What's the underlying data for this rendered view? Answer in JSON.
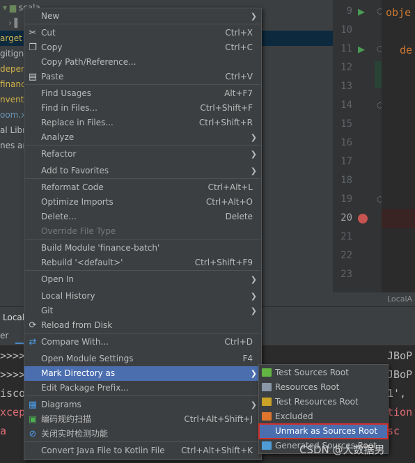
{
  "project_tree": [
    {
      "text": "arget",
      "color": "#d0b34a",
      "selected": true
    },
    {
      "text": "gitigno",
      "color": "#bbbbbb"
    },
    {
      "text": "depend",
      "color": "#d0b34a"
    },
    {
      "text": "finance",
      "color": "#d0b34a"
    },
    {
      "text": "nventor",
      "color": "#d0b34a"
    },
    {
      "text": "oom.x",
      "color": "#6897bb"
    },
    {
      "text": "al Libra",
      "color": "#bbbbbb"
    },
    {
      "text": "nes an",
      "color": "#bbbbbb"
    }
  ],
  "tree_top": {
    "text": "scala"
  },
  "gutter_lines": [
    "9",
    "10",
    "11",
    "12",
    "13",
    "14",
    "15",
    "16",
    "17",
    "18",
    "19",
    "20",
    "21",
    "22",
    "23"
  ],
  "editor_snippets": {
    "line9": "obje",
    "line11": "de"
  },
  "status_strip": {
    "text": "LocalA"
  },
  "bottom_tabs": {
    "tab1": "Local",
    "tab2": "er"
  },
  "console_lines": [
    {
      "text": ">>>>",
      "color": "#bbbbbb",
      "tail": "JBoP"
    },
    {
      "text": ">>>>",
      "color": "#bbbbbb",
      "tail": "JBoP"
    },
    {
      "text": "isco",
      "color": "#bbbbbb",
      "tail": "1',"
    },
    {
      "text": "xcep",
      "color": "#e06c75",
      "tail": "tion"
    },
    {
      "text": "a",
      "color": "#e06c75",
      "tail": "sc"
    }
  ],
  "menu": {
    "items": [
      {
        "label": "New",
        "shortcut": "",
        "submenu": true
      },
      {
        "label": "Cut",
        "shortcut": "Ctrl+X",
        "icon": "scissors-icon"
      },
      {
        "label": "Copy",
        "shortcut": "Ctrl+C",
        "icon": "copy-icon"
      },
      {
        "label": "Copy Path/Reference...",
        "shortcut": ""
      },
      {
        "label": "Paste",
        "shortcut": "Ctrl+V",
        "icon": "paste-icon"
      },
      {
        "label": "Find Usages",
        "shortcut": "Alt+F7"
      },
      {
        "label": "Find in Files...",
        "shortcut": "Ctrl+Shift+F"
      },
      {
        "label": "Replace in Files...",
        "shortcut": "Ctrl+Shift+R"
      },
      {
        "label": "Analyze",
        "shortcut": "",
        "submenu": true
      },
      {
        "label": "Refactor",
        "shortcut": "",
        "submenu": true
      },
      {
        "label": "Add to Favorites",
        "shortcut": "",
        "submenu": true
      },
      {
        "label": "Reformat Code",
        "shortcut": "Ctrl+Alt+L"
      },
      {
        "label": "Optimize Imports",
        "shortcut": "Ctrl+Alt+O"
      },
      {
        "label": "Delete...",
        "shortcut": "Delete"
      },
      {
        "label": "Override File Type",
        "shortcut": "",
        "disabled": true
      },
      {
        "label": "Build Module 'finance-batch'",
        "shortcut": ""
      },
      {
        "label": "Rebuild '<default>'",
        "shortcut": "Ctrl+Shift+F9"
      },
      {
        "label": "Open In",
        "shortcut": "",
        "submenu": true
      },
      {
        "label": "Local History",
        "shortcut": "",
        "submenu": true
      },
      {
        "label": "Git",
        "shortcut": "",
        "submenu": true
      },
      {
        "label": "Reload from Disk",
        "shortcut": "",
        "icon": "reload-icon"
      },
      {
        "label": "Compare With...",
        "shortcut": "Ctrl+D",
        "icon": "compare-icon"
      },
      {
        "label": "Open Module Settings",
        "shortcut": "F4"
      },
      {
        "label": "Mark Directory as",
        "shortcut": "",
        "submenu": true,
        "highlighted": true
      },
      {
        "label": "Edit Package Prefix...",
        "shortcut": ""
      },
      {
        "label": "Diagrams",
        "shortcut": "",
        "submenu": true,
        "icon": "diagram-icon"
      },
      {
        "label": "编码规约扫描",
        "shortcut": "Ctrl+Alt+Shift+J",
        "icon": "scan-icon"
      },
      {
        "label": "关闭实时检测功能",
        "shortcut": "",
        "icon": "disable-icon"
      },
      {
        "label": "Convert Java File to Kotlin File",
        "shortcut": "Ctrl+Alt+Shift+K"
      }
    ]
  },
  "submenu": {
    "items": [
      {
        "label": "Test Sources Root",
        "icon_color": "#62b543"
      },
      {
        "label": "Resources Root",
        "icon_color": "#8a97a8"
      },
      {
        "label": "Test Resources Root",
        "icon_color": "#c9a227"
      },
      {
        "label": "Excluded",
        "icon_color": "#e0752d"
      },
      {
        "label": "Unmark as Sources Root",
        "highlighted": true
      },
      {
        "label": "Generated Sources Root",
        "icon_color": "#4e9bd6"
      }
    ]
  },
  "watermark": "CSDN @大数据男"
}
